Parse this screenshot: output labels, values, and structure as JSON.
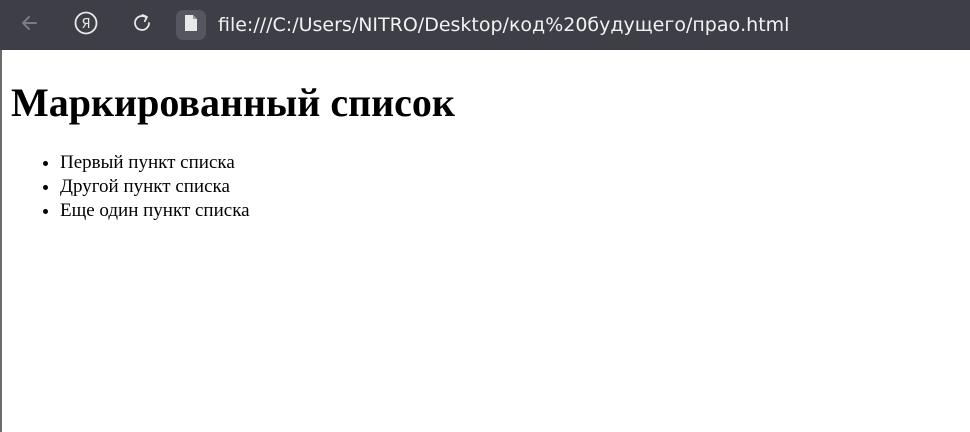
{
  "browser": {
    "url": "file:///C:/Users/NITRO/Desktop/код%20будущего/прао.html",
    "icons": {
      "back": "back-arrow-icon",
      "yandex": "yandex-logo-icon",
      "reload": "reload-icon",
      "file": "file-icon"
    },
    "bar_color": "#3d3e46"
  },
  "page": {
    "title": "Маркированный список",
    "items": [
      "Первый пункт списка",
      "Другой пункт списка",
      "Еще один пункт списка"
    ]
  }
}
